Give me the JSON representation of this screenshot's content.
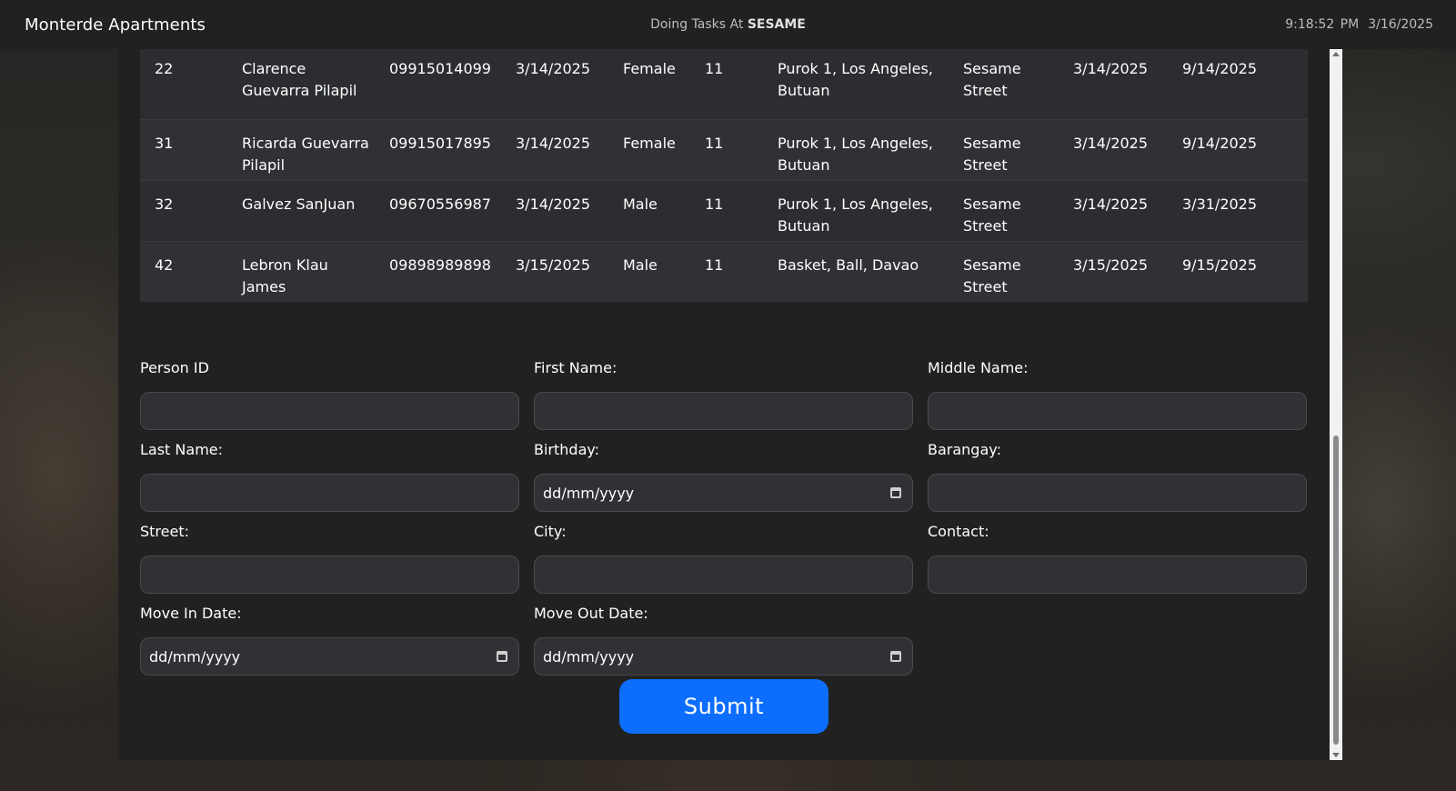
{
  "header": {
    "app_title": "Monterde Apartments",
    "task_prefix": "Doing Tasks At",
    "task_location": "SESAME",
    "time": "9:18:52 PM",
    "date": "3/16/2025"
  },
  "table": {
    "rows": [
      [
        "22",
        "Clarence Guevarra Pilapil",
        "09915014099",
        "3/14/2025",
        "Female",
        "11",
        "Purok 1, Los Angeles, Butuan",
        "Sesame Street",
        "3/14/2025",
        "9/14/2025"
      ],
      [
        "31",
        "Ricarda Guevarra Pilapil",
        "09915017895",
        "3/14/2025",
        "Female",
        "11",
        "Purok 1, Los Angeles, Butuan",
        "Sesame Street",
        "3/14/2025",
        "9/14/2025"
      ],
      [
        "32",
        "Galvez SanJuan",
        "09670556987",
        "3/14/2025",
        "Male",
        "11",
        "Purok 1, Los Angeles, Butuan",
        "Sesame Street",
        "3/14/2025",
        "3/31/2025"
      ],
      [
        "42",
        "Lebron Klau James",
        "09898989898",
        "3/15/2025",
        "Male",
        "11",
        "Basket, Ball, Davao",
        "Sesame Street",
        "3/15/2025",
        "9/15/2025"
      ]
    ]
  },
  "form": {
    "person_id": {
      "label": "Person ID",
      "value": ""
    },
    "first_name": {
      "label": "First Name:",
      "value": ""
    },
    "middle_name": {
      "label": "Middle Name:",
      "value": ""
    },
    "last_name": {
      "label": "Last Name:",
      "value": ""
    },
    "birthday": {
      "label": "Birthday:",
      "value": "dd/mm/yyyy"
    },
    "barangay": {
      "label": "Barangay:",
      "value": ""
    },
    "street": {
      "label": "Street:",
      "value": ""
    },
    "city": {
      "label": "City:",
      "value": ""
    },
    "contact": {
      "label": "Contact:",
      "value": ""
    },
    "move_in": {
      "label": "Move In Date:",
      "value": "dd/mm/yyyy"
    },
    "move_out": {
      "label": "Move Out Date:",
      "value": "dd/mm/yyyy"
    },
    "submit_label": "Submit"
  },
  "colors": {
    "accent": "#0d6efd",
    "panel": "#212121",
    "field_bg": "#2f3134"
  }
}
